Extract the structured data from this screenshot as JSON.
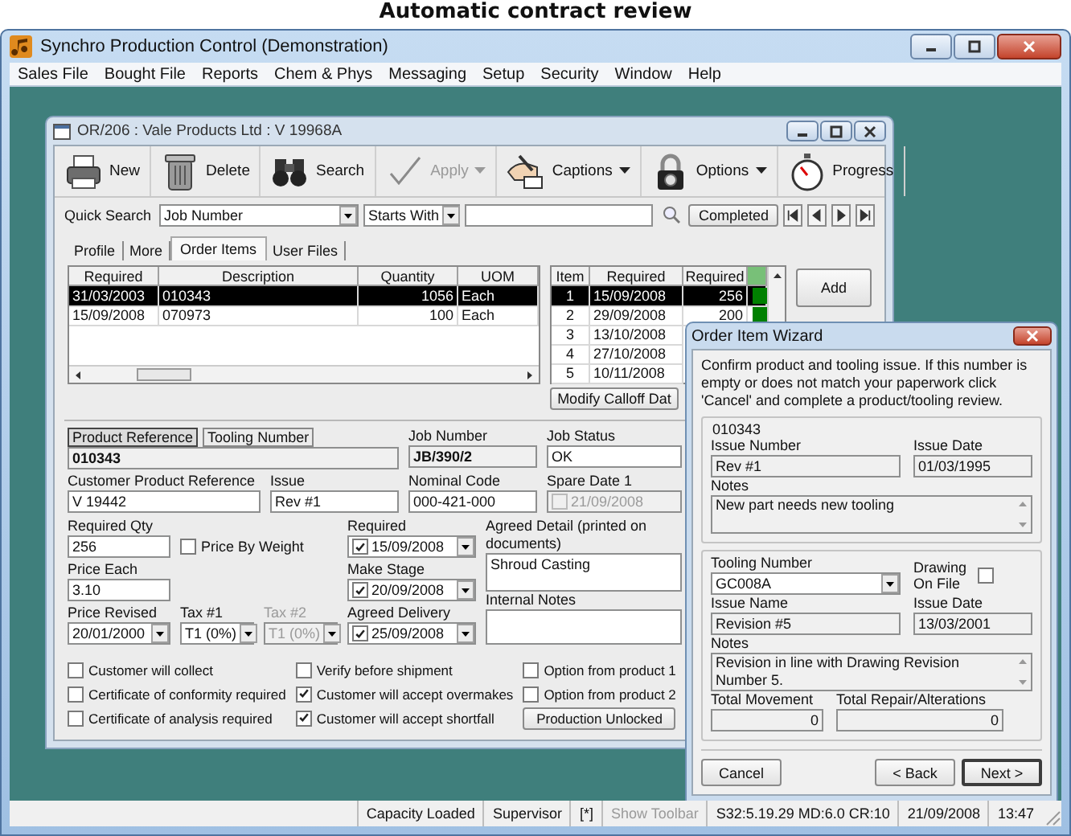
{
  "caption": "Automatic contract review",
  "window": {
    "title": "Synchro Production Control (Demonstration)"
  },
  "menu": [
    "Sales File",
    "Bought File",
    "Reports",
    "Chem & Phys",
    "Messaging",
    "Setup",
    "Security",
    "Window",
    "Help"
  ],
  "child_window": {
    "title": "OR/206 : Vale Products Ltd : V 19968A",
    "toolbar": [
      {
        "label": "New",
        "kind": "printer",
        "disabled": false,
        "dropdown": false
      },
      {
        "label": "Delete",
        "kind": "trash",
        "disabled": false,
        "dropdown": false
      },
      {
        "label": "Search",
        "kind": "binoculars",
        "disabled": false,
        "dropdown": false
      },
      {
        "label": "Apply",
        "kind": "check",
        "disabled": true,
        "dropdown": true
      },
      {
        "label": "Captions",
        "kind": "hand",
        "disabled": false,
        "dropdown": true
      },
      {
        "label": "Options",
        "kind": "padlock",
        "disabled": false,
        "dropdown": true
      },
      {
        "label": "Progress",
        "kind": "stopwatch",
        "disabled": false,
        "dropdown": false
      }
    ],
    "quick_search": {
      "label": "Quick Search",
      "field": "Job Number",
      "mode": "Starts With",
      "filter_button": "Completed"
    },
    "tabs": [
      {
        "label": "Profile",
        "selected": false
      },
      {
        "label": "More",
        "selected": false
      },
      {
        "label": "Order Items",
        "selected": true
      },
      {
        "label": "User Files",
        "selected": false
      }
    ],
    "items_table": {
      "columns": [
        "Required",
        "Description",
        "Quantity",
        "UOM"
      ],
      "rows": [
        {
          "cells": [
            "31/03/2003",
            "010343",
            "1056",
            "Each"
          ],
          "selected": true
        },
        {
          "cells": [
            "15/09/2008",
            "070973",
            "100",
            "Each"
          ],
          "selected": false
        }
      ]
    },
    "calloff_table": {
      "columns": [
        "Item",
        "Required",
        "Required"
      ],
      "rows": [
        {
          "cells": [
            "1",
            "15/09/2008",
            "256"
          ],
          "selected": true,
          "color": "#008000"
        },
        {
          "cells": [
            "2",
            "29/09/2008",
            "200"
          ],
          "selected": false,
          "color": "#008000"
        },
        {
          "cells": [
            "3",
            "13/10/2008"
          ],
          "selected": false
        },
        {
          "cells": [
            "4",
            "27/10/2008"
          ],
          "selected": false
        },
        {
          "cells": [
            "5",
            "10/11/2008"
          ],
          "selected": false
        }
      ]
    },
    "modify_button": "Modify Calloff Dat",
    "add_button": "Add",
    "form": {
      "reference_tabs": [
        {
          "label": "Product Reference",
          "selected": true
        },
        {
          "label": "Tooling Number",
          "selected": false
        }
      ],
      "reference_value": "010343",
      "job_number": {
        "label": "Job Number",
        "value": "JB/390/2"
      },
      "job_status": {
        "label": "Job Status",
        "value": "OK"
      },
      "customer_product_reference": {
        "label": "Customer Product Reference",
        "value": "V 19442"
      },
      "issue": {
        "label": "Issue",
        "value": "Rev #1"
      },
      "nominal_code": {
        "label": "Nominal Code",
        "value": "000-421-000"
      },
      "spare_date_1": {
        "label": "Spare Date 1",
        "value": "21/09/2008",
        "checked": false,
        "disabled": true
      },
      "required_qty": {
        "label": "Required Qty",
        "value": "256"
      },
      "price_by_weight": {
        "label": "Price By Weight",
        "checked": false
      },
      "price_each": {
        "label": "Price Each",
        "value": "3.10"
      },
      "price_revised": {
        "label": "Price Revised",
        "value": "20/01/2000"
      },
      "tax_1": {
        "label": "Tax #1",
        "value": "T1 (0%)",
        "disabled": false
      },
      "tax_2": {
        "label": "Tax #2",
        "value": "T1 (0%)",
        "disabled": true
      },
      "required_date": {
        "label": "Required",
        "value": "15/09/2008",
        "checked": true
      },
      "make_stage": {
        "label": "Make Stage",
        "value": "20/09/2008",
        "checked": true
      },
      "agreed_delivery": {
        "label": "Agreed Delivery",
        "value": "25/09/2008",
        "checked": true
      },
      "agreed_detail": {
        "label": "Agreed Detail  (printed on documents)",
        "value": "Shroud Casting"
      },
      "internal_notes": {
        "label": "Internal Notes"
      },
      "options": [
        {
          "label": "Customer will collect",
          "checked": false
        },
        {
          "label": "Certificate of conformity required",
          "checked": false
        },
        {
          "label": "Certificate of analysis required",
          "checked": false
        },
        {
          "label": "Verify before shipment",
          "checked": false
        },
        {
          "label": "Customer will accept overmakes",
          "checked": true
        },
        {
          "label": "Customer will accept shortfall",
          "checked": true
        },
        {
          "label": "Option from product 1",
          "checked": false
        },
        {
          "label": "Option from product 2",
          "checked": false
        }
      ],
      "production_button": "Production Unlocked"
    }
  },
  "wizard": {
    "title": "Order Item Wizard",
    "intro": "Confirm product and tooling issue. If this number is empty or does not match your paperwork click 'Cancel' and complete a product/tooling review.",
    "product_group": {
      "legend": "010343",
      "issue_number": {
        "label": "Issue Number",
        "value": "Rev #1"
      },
      "issue_date": {
        "label": "Issue Date",
        "value": "01/03/1995"
      },
      "notes": {
        "label": "Notes",
        "value": "New part needs new tooling"
      }
    },
    "tooling_group": {
      "tooling_number": {
        "label": "Tooling Number",
        "value": "GC008A"
      },
      "drawing_on_file": {
        "label": "Drawing On File",
        "checked": false
      },
      "issue_name": {
        "label": "Issue Name",
        "value": "Revision #5"
      },
      "issue_date": {
        "label": "Issue Date",
        "value": "13/03/2001"
      },
      "notes": {
        "label": "Notes",
        "value": "Revision in line with Drawing Revision Number 5."
      },
      "total_movement": {
        "label": "Total Movement",
        "value": "0"
      },
      "total_repair": {
        "label": "Total Repair/Alterations",
        "value": "0"
      }
    },
    "buttons": [
      {
        "label": "Cancel",
        "default": false
      },
      {
        "label": "< Back",
        "default": false
      },
      {
        "label": "Next >",
        "default": true
      }
    ]
  },
  "status_bar": [
    {
      "text": "Capacity Loaded",
      "disabled": false
    },
    {
      "text": "Supervisor",
      "disabled": false
    },
    {
      "text": "[*]",
      "disabled": false
    },
    {
      "text": "Show Toolbar",
      "disabled": true
    },
    {
      "text": "S32:5.19.29 MD:6.0 CR:10",
      "disabled": false
    },
    {
      "text": "21/09/2008",
      "disabled": false
    },
    {
      "text": "13:47",
      "disabled": false
    }
  ]
}
